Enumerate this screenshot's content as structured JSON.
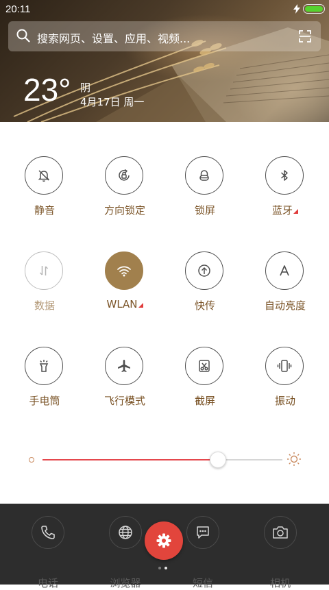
{
  "status_bar": {
    "time": "20:11",
    "battery_level": 1.0,
    "charging_icon": "bolt-icon"
  },
  "search": {
    "placeholder": "搜索网页、设置、应用、视频...",
    "left_icon": "search-icon",
    "right_icon": "scan-icon"
  },
  "weather": {
    "temperature": "23°",
    "condition": "阴",
    "date": "4月17日 周一"
  },
  "toggles": [
    {
      "label": "静音",
      "icon": "bell-off-icon",
      "state": "off",
      "has_more": false
    },
    {
      "label": "方向锁定",
      "icon": "rotation-lock-icon",
      "state": "off",
      "has_more": false
    },
    {
      "label": "锁屏",
      "icon": "lock-icon",
      "state": "off",
      "has_more": false
    },
    {
      "label": "蓝牙",
      "icon": "bluetooth-icon",
      "state": "off",
      "has_more": true
    },
    {
      "label": "数据",
      "icon": "mobile-data-icon",
      "state": "disabled",
      "has_more": false
    },
    {
      "label": "WLAN",
      "icon": "wifi-icon",
      "state": "on",
      "has_more": true
    },
    {
      "label": "快传",
      "icon": "share-upload-icon",
      "state": "off",
      "has_more": false
    },
    {
      "label": "自动亮度",
      "icon": "auto-brightness-icon",
      "state": "off",
      "has_more": false
    },
    {
      "label": "手电筒",
      "icon": "flashlight-icon",
      "state": "off",
      "has_more": false
    },
    {
      "label": "飞行模式",
      "icon": "airplane-icon",
      "state": "off",
      "has_more": false
    },
    {
      "label": "截屏",
      "icon": "screenshot-icon",
      "state": "off",
      "has_more": false
    },
    {
      "label": "振动",
      "icon": "vibrate-icon",
      "state": "off",
      "has_more": false
    }
  ],
  "brightness": {
    "level": 0.73,
    "low_icon": "brightness-low-icon",
    "high_icon": "brightness-high-icon",
    "fill_color": "#e5484d"
  },
  "dock": {
    "items": [
      {
        "label": "电话",
        "icon": "phone-icon"
      },
      {
        "label": "浏览器",
        "icon": "globe-icon"
      },
      {
        "label": "短信",
        "icon": "message-icon"
      },
      {
        "label": "相机",
        "icon": "camera-icon"
      }
    ],
    "settings_button_icon": "gear-icon",
    "settings_button_color": "#e2453c",
    "page_count": 2,
    "current_page": 2
  },
  "colors": {
    "accent": "#a1804d",
    "label": "#7a5326",
    "active_tile": "#a1804d",
    "more_indicator": "#e03c3c"
  }
}
